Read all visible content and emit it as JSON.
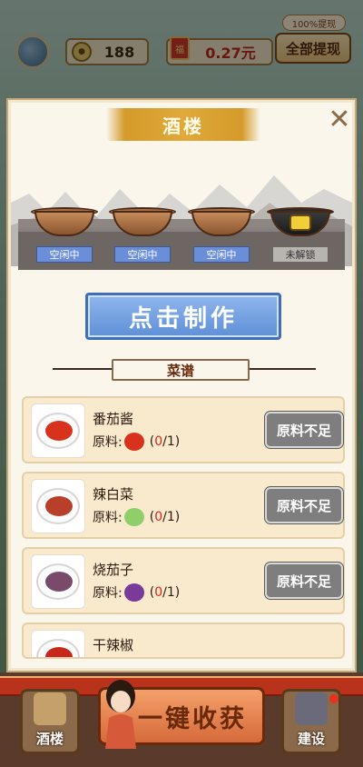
{
  "topbar": {
    "coins": "188",
    "money": "0.27元",
    "fu_icon": "福",
    "withdraw_all": "全部提现",
    "withdraw_tag": "100%提现"
  },
  "modal": {
    "title": "酒楼",
    "close_icon": "close-icon",
    "woks": [
      {
        "status": "空闲中",
        "locked": false
      },
      {
        "status": "空闲中",
        "locked": false
      },
      {
        "status": "空闲中",
        "locked": false
      },
      {
        "status": "未解锁",
        "locked": true
      }
    ],
    "make_button": "点击制作",
    "recipe_header": "菜谱",
    "recipes": [
      {
        "name": "番茄酱",
        "ingredient_label": "原料:",
        "ingredient": "tomato",
        "have": "0",
        "need": "1",
        "button": "原料不足"
      },
      {
        "name": "辣白菜",
        "ingredient_label": "原料:",
        "ingredient": "cabbage",
        "have": "0",
        "need": "1",
        "button": "原料不足"
      },
      {
        "name": "烧茄子",
        "ingredient_label": "原料:",
        "ingredient": "eggplant",
        "have": "0",
        "need": "1",
        "button": "原料不足"
      },
      {
        "name": "干辣椒"
      }
    ]
  },
  "bottom": {
    "restaurant": "酒楼",
    "harvest": "一键收获",
    "build": "建设"
  },
  "colors": {
    "accent_blue": "#5e8fd6",
    "title_gold": "#d49a2a",
    "warning_red": "#d2281c",
    "disabled_gray": "#7e7e7e"
  }
}
